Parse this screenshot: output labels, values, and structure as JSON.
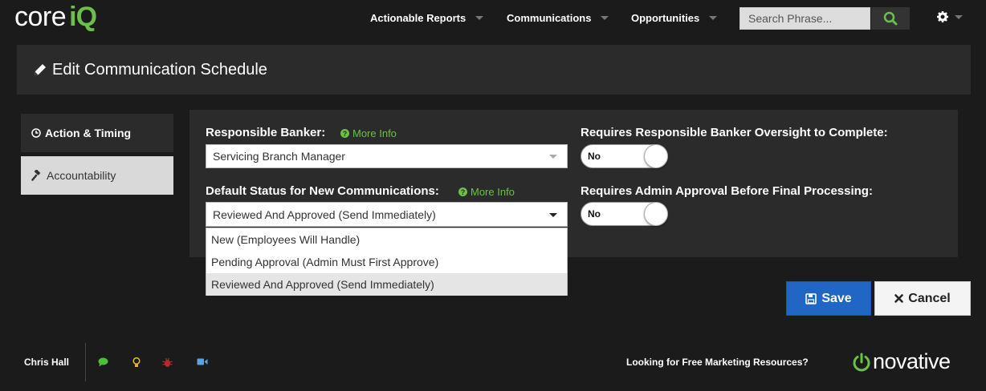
{
  "brand": {
    "logo_part1": "core",
    "logo_part2": "iQ",
    "accent_color": "#6cc04a"
  },
  "nav": {
    "items": [
      {
        "label": "Actionable Reports"
      },
      {
        "label": "Communications"
      },
      {
        "label": "Opportunities"
      }
    ],
    "search_placeholder": "Search Phrase...",
    "search_value": ""
  },
  "page": {
    "title": "Edit Communication Schedule"
  },
  "tabs": [
    {
      "label": "Action & Timing",
      "icon": "clock-icon",
      "active": true
    },
    {
      "label": "Accountability",
      "icon": "gavel-icon",
      "active": false
    }
  ],
  "form": {
    "responsible_banker": {
      "label": "Responsible Banker:",
      "more_info": "More Info",
      "value": "Servicing Branch Manager"
    },
    "default_status": {
      "label": "Default Status for New Communications:",
      "more_info": "More Info",
      "value": "Reviewed And Approved (Send Immediately)",
      "options": [
        "New (Employees Will Handle)",
        "Pending Approval (Admin Must First Approve)",
        "Reviewed And Approved (Send Immediately)"
      ]
    },
    "oversight": {
      "label": "Requires Responsible Banker Oversight to Complete:",
      "toggle": "No"
    },
    "admin_approval": {
      "label": "Requires Admin Approval Before Final Processing:",
      "toggle": "No"
    }
  },
  "buttons": {
    "save": "Save",
    "cancel": "Cancel"
  },
  "footer": {
    "user": "Chris Hall",
    "icons": [
      "chat-icon",
      "lightbulb-icon",
      "bug-icon",
      "video-icon"
    ],
    "promo": "Looking for Free Marketing Resources?",
    "partner_logo": "novative"
  },
  "colors": {
    "primary_button": "#2166c5",
    "background": "#1b1b1b",
    "panel": "#2b2b2b"
  }
}
